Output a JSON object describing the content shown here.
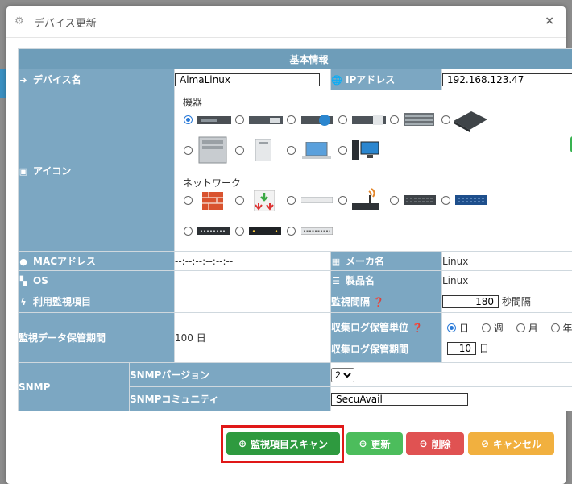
{
  "modal": {
    "title": "デバイス更新",
    "close_symbol": "×"
  },
  "section_header": "基本情報",
  "labels": {
    "device_name": "デバイス名",
    "ip_address": "IPアドレス",
    "icon": "アイコン",
    "mac": "MACアドレス",
    "maker": "メーカ名",
    "os": "OS",
    "product": "製品名",
    "monitor_items": "利用監視項目",
    "monitor_interval": "監視間隔",
    "data_retention": "監視データ保管期間",
    "log_unit": "収集ログ保管単位",
    "log_period": "収集ログ保管期間",
    "snmp": "SNMP",
    "snmp_version": "SNMPバージョン",
    "snmp_community": "SNMPコミュニティ"
  },
  "values": {
    "device_name": "AlmaLinux",
    "ip_address": "192.168.123.47",
    "mac": "--:--:--:--:--:--",
    "maker": "Linux",
    "os": "",
    "product": "Linux",
    "monitor_items": "",
    "monitor_interval": "180",
    "monitor_interval_unit": "秒間隔",
    "data_retention": "100 日",
    "log_period": "10",
    "log_period_unit": "日",
    "snmp_version": "2",
    "snmp_community": "SecuAvail"
  },
  "icon_groups": {
    "equipment": "機器",
    "network": "ネットワーク"
  },
  "log_unit_options": [
    "日",
    "週",
    "月",
    "年"
  ],
  "log_unit_selected": "日",
  "buttons": {
    "scan": "監視項目スキャン",
    "update": "更新",
    "delete": "削除",
    "cancel": "キャンセル"
  },
  "colors": {
    "header_blue": "#6e9db9",
    "label_blue": "#7ca7c2",
    "scan_green": "#2e9a3f",
    "update_green": "#4cbd5c",
    "delete_red": "#e05252",
    "cancel_orange": "#f1b03f",
    "highlight_red": "#e01818"
  }
}
